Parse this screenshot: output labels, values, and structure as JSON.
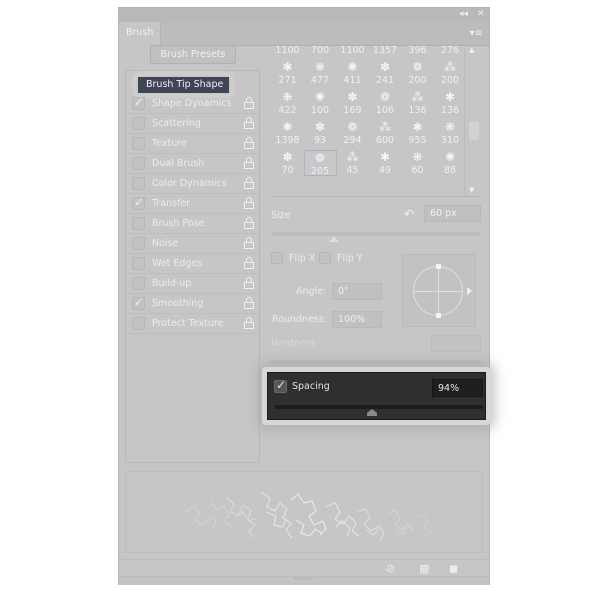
{
  "window": {
    "collapse_icon": "double-chevron-left-icon",
    "close_icon": "close-icon",
    "tab_label": "Brush",
    "panel_menu_icon": "panel-menu-icon"
  },
  "presets_button": "Brush Presets",
  "brush_tip_shape": "Brush Tip Shape",
  "options": [
    {
      "label": "Shape Dynamics",
      "checked": true
    },
    {
      "label": "Scattering",
      "checked": false
    },
    {
      "label": "Texture",
      "checked": false
    },
    {
      "label": "Dual Brush",
      "checked": false
    },
    {
      "label": "Color Dynamics",
      "checked": false
    },
    {
      "label": "Transfer",
      "checked": true
    },
    {
      "label": "Brush Pose",
      "checked": false
    },
    {
      "label": "Noise",
      "checked": false
    },
    {
      "label": "Wet Edges",
      "checked": false
    },
    {
      "label": "Build-up",
      "checked": false
    },
    {
      "label": "Smoothing",
      "checked": true
    },
    {
      "label": "Protect Texture",
      "checked": false
    }
  ],
  "brush_grid": [
    [
      "1100",
      "700",
      "1100",
      "1357",
      "396",
      "276"
    ],
    [
      "271",
      "477",
      "411",
      "241",
      "200",
      "200"
    ],
    [
      "422",
      "100",
      "169",
      "106",
      "136",
      "136"
    ],
    [
      "1398",
      "93",
      "294",
      "600",
      "955",
      "310"
    ],
    [
      "70",
      "205",
      "45",
      "49",
      "60",
      "88"
    ]
  ],
  "selected_brush": "205",
  "size": {
    "label": "Size",
    "value": "60 px",
    "slider_fraction": 0.3
  },
  "flip_x": {
    "label": "Flip X",
    "checked": false
  },
  "flip_y": {
    "label": "Flip Y",
    "checked": false
  },
  "angle": {
    "label": "Angle:",
    "value": "0°"
  },
  "roundness": {
    "label": "Roundness:",
    "value": "100%"
  },
  "hardness": {
    "label": "Hardness",
    "value": ""
  },
  "spacing": {
    "label": "Spacing",
    "checked": true,
    "value": "94%",
    "slider_fraction": 0.47
  },
  "footer_icons": [
    "brush-toggle-icon",
    "grid-view-icon",
    "new-preset-icon"
  ]
}
